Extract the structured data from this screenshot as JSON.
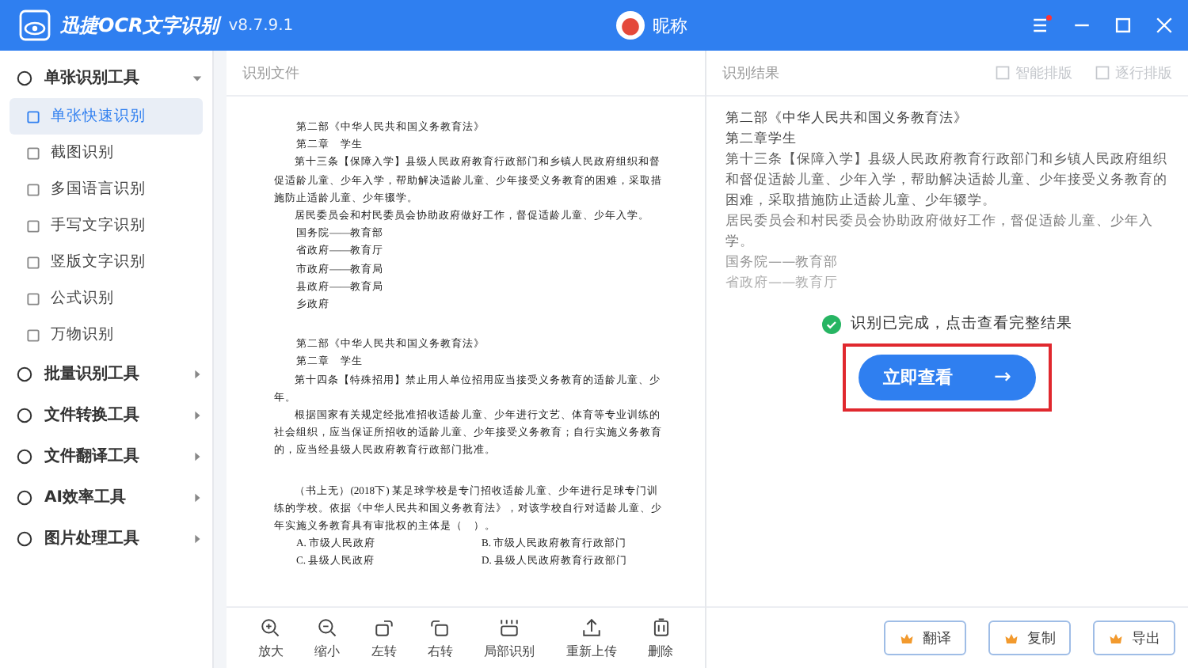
{
  "titlebar": {
    "app_name": "迅捷OCR文字识别",
    "version": "v8.7.9.1",
    "user_name": "昵称",
    "menu_badge": true
  },
  "sidebar": {
    "groups": [
      {
        "label": "单张识别工具",
        "expanded": true,
        "items": [
          {
            "label": "单张快速识别",
            "selected": true
          },
          {
            "label": "截图识别",
            "selected": false
          },
          {
            "label": "多国语言识别",
            "selected": false
          },
          {
            "label": "手写文字识别",
            "selected": false
          },
          {
            "label": "竖版文字识别",
            "selected": false
          },
          {
            "label": "公式识别",
            "selected": false
          },
          {
            "label": "万物识别",
            "selected": false
          }
        ]
      },
      {
        "label": "批量识别工具",
        "expanded": false
      },
      {
        "label": "文件转换工具",
        "expanded": false
      },
      {
        "label": "文件翻译工具",
        "expanded": false
      },
      {
        "label": "AI效率工具",
        "expanded": false
      },
      {
        "label": "图片处理工具",
        "expanded": false
      }
    ]
  },
  "source_panel": {
    "title": "识别文件",
    "document": [
      {
        "kind": "line",
        "text": "第二部《中华人民共和国义务教育法》"
      },
      {
        "kind": "line",
        "text": "第二章　学生"
      },
      {
        "kind": "para",
        "text": "第十三条【保障入学】县级人民政府教育行政部门和乡镇人民政府组织和督促适龄儿童、少年入学，帮助解决适龄儿童、少年接受义务教育的困难，采取措施防止适龄儿童、少年辍学。"
      },
      {
        "kind": "para",
        "text": "居民委员会和村民委员会协助政府做好工作，督促适龄儿童、少年入学。"
      },
      {
        "kind": "line",
        "text": "国务院——教育部"
      },
      {
        "kind": "line",
        "text": "省政府——教育厅"
      },
      {
        "kind": "line",
        "text": "市政府——教育局"
      },
      {
        "kind": "line",
        "text": "县政府——教育局"
      },
      {
        "kind": "line",
        "text": "乡政府"
      },
      {
        "kind": "gap"
      },
      {
        "kind": "line",
        "text": "第二部《中华人民共和国义务教育法》"
      },
      {
        "kind": "line",
        "text": "第二章　学生"
      },
      {
        "kind": "para",
        "text": "第十四条【特殊招用】禁止用人单位招用应当接受义务教育的适龄儿童、少年。"
      },
      {
        "kind": "para",
        "text": "根据国家有关规定经批准招收适龄儿童、少年进行文艺、体育等专业训练的社会组织，应当保证所招收的适龄儿童、少年接受义务教育；自行实施义务教育的，应当经县级人民政府教育行政部门批准。"
      },
      {
        "kind": "gap"
      },
      {
        "kind": "para",
        "text": "（书上无）(2018下) 某足球学校是专门招收适龄儿童、少年进行足球专门训练的学校。依据《中华人民共和国义务教育法》，对该学校自行对适龄儿童、少年实施义务教育具有审批权的主体是（　）。"
      },
      {
        "kind": "options",
        "text": "A. 市级人民政府",
        "text2": "B. 市级人民政府教育行政部门"
      },
      {
        "kind": "options",
        "text": "C. 县级人民政府",
        "text2": "D. 县级人民政府教育行政部门"
      }
    ],
    "tools": [
      {
        "kind": "zoom-in",
        "label": "放大"
      },
      {
        "kind": "zoom-out",
        "label": "缩小"
      },
      {
        "kind": "rotate-left",
        "label": "左转"
      },
      {
        "kind": "rotate-right",
        "label": "右转"
      },
      {
        "kind": "crop",
        "label": "局部识别"
      },
      {
        "kind": "upload",
        "label": "重新上传"
      },
      {
        "kind": "delete",
        "label": "删除"
      }
    ]
  },
  "result_panel": {
    "title": "识别结果",
    "layout_buttons": [
      {
        "label": "智能排版",
        "disabled": true
      },
      {
        "label": "逐行排版",
        "disabled": true
      }
    ],
    "preview": [
      "第二部《中华人民共和国义务教育法》",
      "第二章学生",
      "第十三条【保障入学】县级人民政府教育行政部门和乡镇人民政府组织和督促适龄儿童、少年入学，帮助解决适龄儿童、少年接受义务教育的困难，采取措施防止适龄儿童、少年辍学。",
      "居民委员会和村民委员会协助政府做好工作，督促适龄儿童、少年入学。",
      "国务院——教育部",
      "省政府——教育厅"
    ],
    "status": "识别已完成，点击查看完整结果",
    "view_button": {
      "label": "立即查看",
      "arrow": "→",
      "highlighted": true
    },
    "actions": [
      "翻译",
      "复制",
      "导出"
    ]
  }
}
